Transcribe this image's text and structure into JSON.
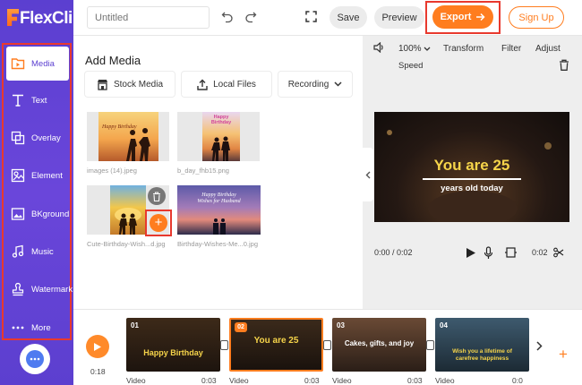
{
  "app": {
    "logo_flex": "Flex",
    "logo_clip": "Clip"
  },
  "sidebar": {
    "items": [
      {
        "label": "Media",
        "icon": "media-folder-icon",
        "active": true
      },
      {
        "label": "Text",
        "icon": "text-icon"
      },
      {
        "label": "Overlay",
        "icon": "overlay-icon"
      },
      {
        "label": "Element",
        "icon": "element-icon"
      },
      {
        "label": "BKground",
        "icon": "background-icon"
      },
      {
        "label": "Music",
        "icon": "music-note-icon"
      },
      {
        "label": "Watermark",
        "icon": "watermark-stamp-icon"
      },
      {
        "label": "More",
        "icon": "more-dots-icon"
      }
    ]
  },
  "topbar": {
    "title_placeholder": "Untitled",
    "save_label": "Save",
    "preview_label": "Preview",
    "export_label": "Export",
    "signup_label": "Sign Up"
  },
  "media_panel": {
    "title": "Add Media",
    "stock_label": "Stock Media",
    "local_label": "Local Files",
    "recording_label": "Recording",
    "thumb1_text": "Happy Birthday",
    "thumb2_text": "Happy Birthday",
    "thumb4_text": "Happy Birthday Wishes for Husband",
    "files": [
      "images (14).jpeg",
      "b_day_fhb15.png",
      "Cute-Birthday-Wish...d.jpg",
      "Birthday-Wishes-Me...0.jpg"
    ]
  },
  "preview_panel": {
    "volume_icon": "speaker-icon",
    "zoom": "100%",
    "transform_label": "Transform",
    "filter_label": "Filter",
    "adjust_label": "Adjust",
    "speed_label": "Speed",
    "video_title": "You are 25",
    "video_subtitle": "years old today",
    "current_time": "0:00 / 0:02",
    "duration": "0:02"
  },
  "timeline": {
    "current_time": "0:18",
    "clips": [
      {
        "num": "01",
        "text": "Happy Birthday",
        "label": "Video",
        "dur": "0:03"
      },
      {
        "num": "02",
        "text": "You are 25",
        "label": "Video",
        "dur": "0:03"
      },
      {
        "num": "03",
        "text": "Cakes, gifts, and joy",
        "label": "Video",
        "dur": "0:03"
      },
      {
        "num": "04",
        "text": "Wish you a lifetime of carefree happiness",
        "label": "Video",
        "dur": "0:0"
      }
    ]
  },
  "colors": {
    "sidebar": "#5b3fd0",
    "accent": "#ff7d1f",
    "highlight": "#e8392e"
  }
}
